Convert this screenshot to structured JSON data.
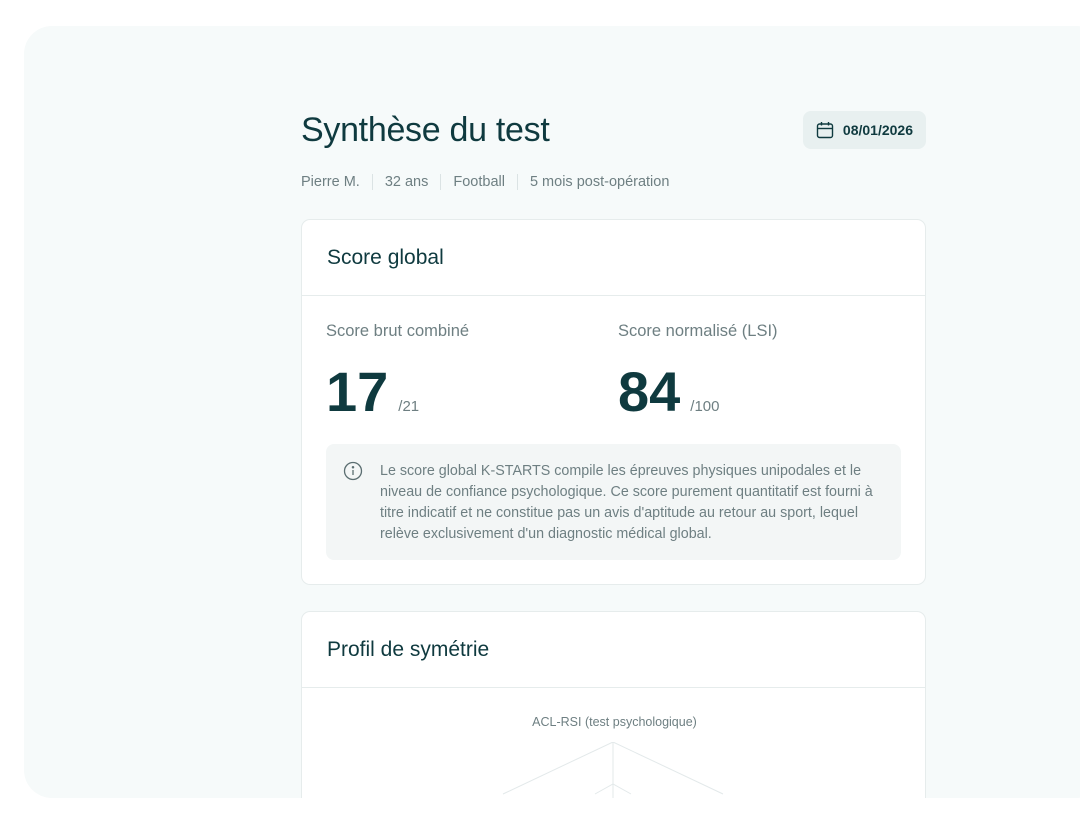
{
  "page": {
    "title": "Synthèse du test",
    "date": "08/01/2026",
    "meta": [
      "Pierre M.",
      "32 ans",
      "Football",
      "5 mois post-opération"
    ]
  },
  "score_card": {
    "title": "Score global",
    "raw": {
      "label": "Score brut combiné",
      "value": "17",
      "max": "/21"
    },
    "normalized": {
      "label": "Score normalisé (LSI)",
      "value": "84",
      "max": "/100"
    },
    "info": "Le score global K-STARTS compile les épreuves physiques unipodales et le niveau de confiance psychologique. Ce score purement quantitatif est fourni à titre indicatif et ne constitue pas un avis d'aptitude au retour au sport, lequel relève exclusivement d'un diagnostic médical global."
  },
  "symmetry_card": {
    "title": "Profil de symétrie",
    "axis_top_label": "ACL-RSI (test psychologique)"
  },
  "icons": {
    "date": "calendar-icon",
    "info": "info-icon"
  },
  "colors": {
    "primary": "#0f3a3f",
    "muted": "#6e7f82",
    "frame_bg": "#f6fafa",
    "chip_bg": "#e8f0f0"
  }
}
